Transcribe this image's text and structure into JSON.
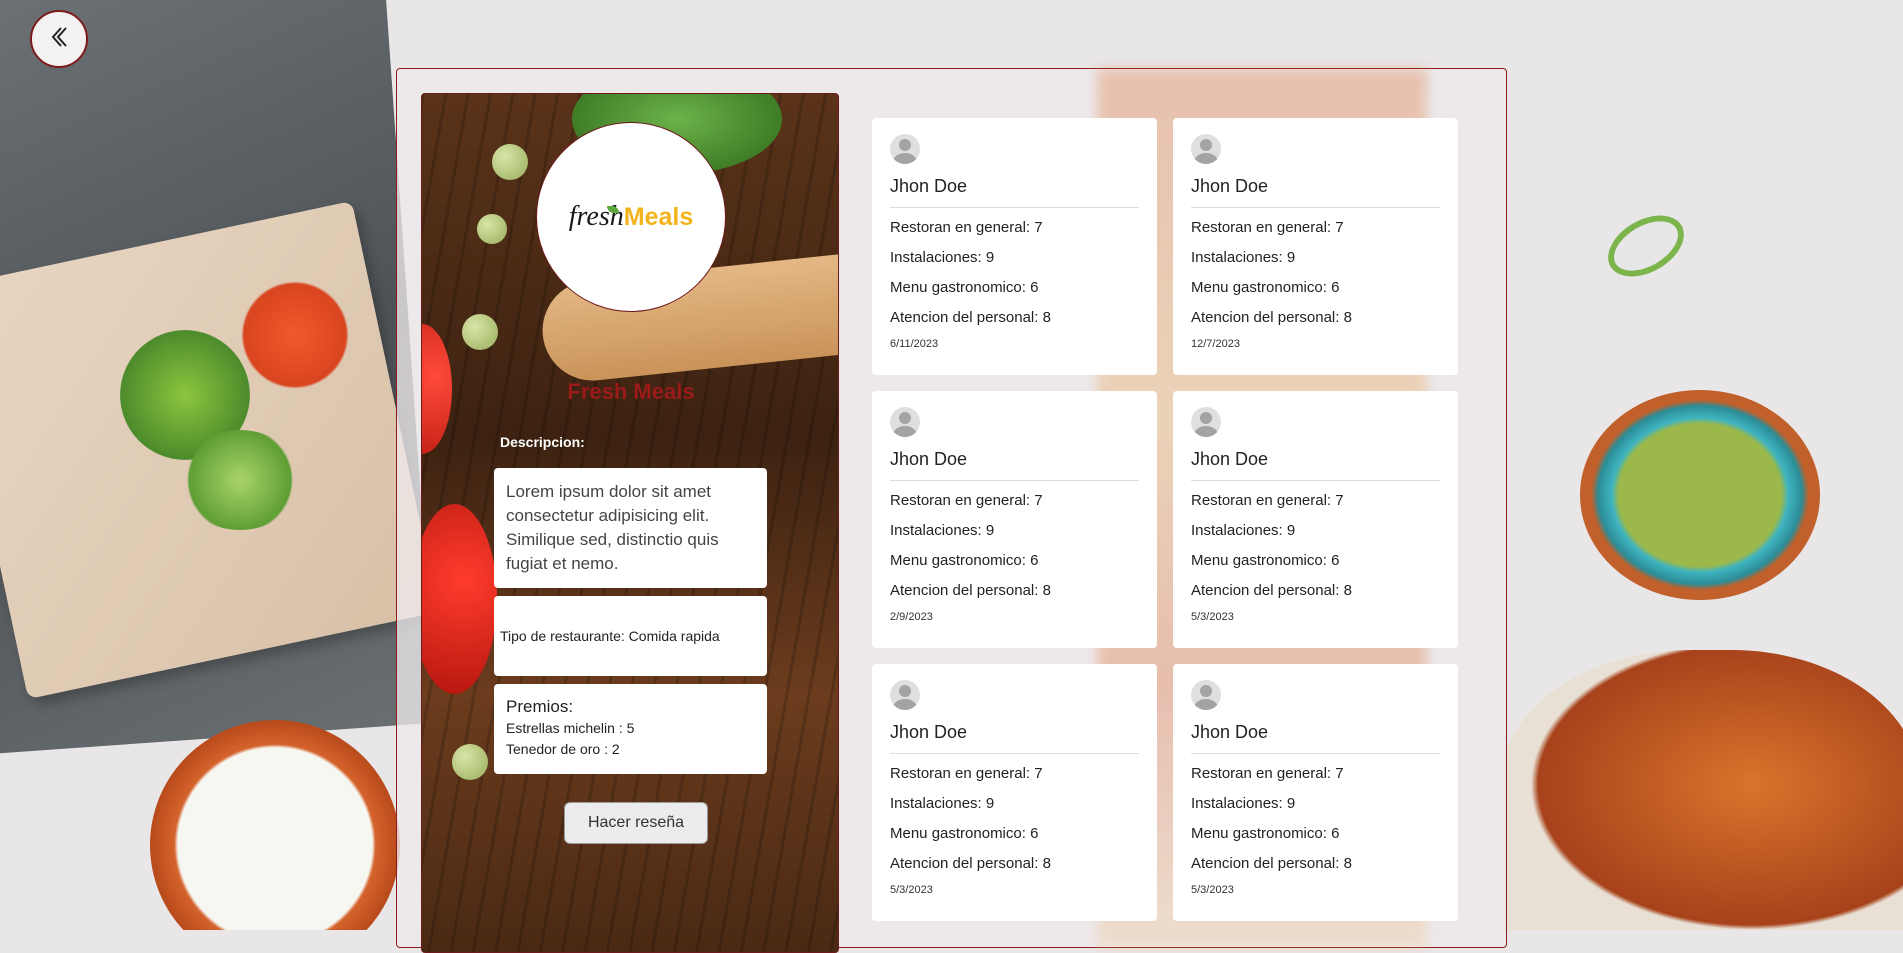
{
  "back_button": {
    "icon": "chevron-left-icon"
  },
  "restaurant": {
    "logo": {
      "part1": "fresh",
      "part2": "Meals"
    },
    "name": "Fresh Meals",
    "description_label": "Descripcion:",
    "description": "Lorem ipsum dolor sit amet consectetur adipisicing elit. Similique sed, distinctio quis fugiat et nemo.",
    "type_label": "Tipo de restaurante: Comida rapida",
    "awards": {
      "title": "Premios:",
      "michelin": "Estrellas michelin : 5",
      "tenedor": "Tenedor de oro : 2"
    },
    "review_button": "Hacer reseña"
  },
  "reviews": [
    {
      "name": "Jhon Doe",
      "general": "Restoran en general: 7",
      "instalaciones": "Instalaciones: 9",
      "menu": "Menu gastronomico: 6",
      "atencion": "Atencion del personal: 8",
      "date": "6/11/2023"
    },
    {
      "name": "Jhon Doe",
      "general": "Restoran en general: 7",
      "instalaciones": "Instalaciones: 9",
      "menu": "Menu gastronomico: 6",
      "atencion": "Atencion del personal: 8",
      "date": "12/7/2023"
    },
    {
      "name": "Jhon Doe",
      "general": "Restoran en general: 7",
      "instalaciones": "Instalaciones: 9",
      "menu": "Menu gastronomico: 6",
      "atencion": "Atencion del personal: 8",
      "date": "2/9/2023"
    },
    {
      "name": "Jhon Doe",
      "general": "Restoran en general: 7",
      "instalaciones": "Instalaciones: 9",
      "menu": "Menu gastronomico: 6",
      "atencion": "Atencion del personal: 8",
      "date": "5/3/2023"
    },
    {
      "name": "Jhon Doe",
      "general": "Restoran en general: 7",
      "instalaciones": "Instalaciones: 9",
      "menu": "Menu gastronomico: 6",
      "atencion": "Atencion del personal: 8",
      "date": "5/3/2023"
    },
    {
      "name": "Jhon Doe",
      "general": "Restoran en general: 7",
      "instalaciones": "Instalaciones: 9",
      "menu": "Menu gastronomico: 6",
      "atencion": "Atencion del personal: 8",
      "date": "5/3/2023"
    }
  ],
  "colors": {
    "accent": "#9b1a1a",
    "logo_yellow": "#f2b41a"
  }
}
